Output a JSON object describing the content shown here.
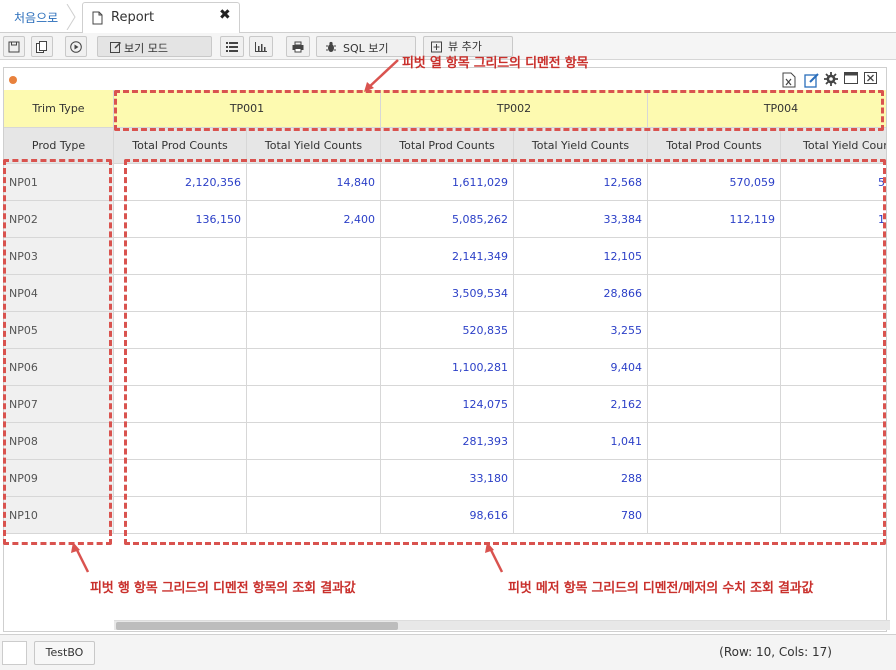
{
  "tabbar": {
    "home_label": "처음으로",
    "tab_label": "Report",
    "close_label": "✖"
  },
  "toolbar": {
    "view_mode_label": "보기 모드",
    "sql_view_label": "SQL 보기",
    "add_view_label": "뷰 추가"
  },
  "grid": {
    "col_dim_header": "Trim Type",
    "row_dim_header": "Prod Type",
    "col_groups": [
      "TP001",
      "TP002",
      "TP004"
    ],
    "measures": [
      "Total Prod Counts",
      "Total Yield Counts",
      "Total Prod Counts",
      "Total Yield Counts",
      "Total Prod Counts",
      "Total Yield Count"
    ],
    "rows": [
      {
        "label": "NP01",
        "values": [
          "2,120,356",
          "14,840",
          "1,611,029",
          "12,568",
          "570,059",
          "5"
        ]
      },
      {
        "label": "NP02",
        "values": [
          "136,150",
          "2,400",
          "5,085,262",
          "33,384",
          "112,119",
          "1"
        ]
      },
      {
        "label": "NP03",
        "values": [
          "",
          "",
          "2,141,349",
          "12,105",
          "",
          ""
        ]
      },
      {
        "label": "NP04",
        "values": [
          "",
          "",
          "3,509,534",
          "28,866",
          "",
          ""
        ]
      },
      {
        "label": "NP05",
        "values": [
          "",
          "",
          "520,835",
          "3,255",
          "",
          ""
        ]
      },
      {
        "label": "NP06",
        "values": [
          "",
          "",
          "1,100,281",
          "9,404",
          "",
          ""
        ]
      },
      {
        "label": "NP07",
        "values": [
          "",
          "",
          "124,075",
          "2,162",
          "",
          ""
        ]
      },
      {
        "label": "NP08",
        "values": [
          "",
          "",
          "281,393",
          "1,041",
          "",
          ""
        ]
      },
      {
        "label": "NP09",
        "values": [
          "",
          "",
          "33,180",
          "288",
          "",
          ""
        ]
      },
      {
        "label": "NP10",
        "values": [
          "",
          "",
          "98,616",
          "780",
          "",
          ""
        ]
      }
    ]
  },
  "annotations": {
    "col_dim": "피벗 열 항목 그리드의 디멘전 항목",
    "row_dim": "피벗 행 항목 그리드의 디멘전 항목의 조회 결과값",
    "measure": "피벗 메저 항목 그리드의 디멘전/메저의 수치 조회 결과값"
  },
  "statusbar": {
    "button_label": "TestBO",
    "info": "(Row: 10, Cols: 17)"
  },
  "colors": {
    "annotation": "#d9534f",
    "header_yellow": "#fdfab0",
    "value_blue": "#2b3fc7",
    "dot_orange": "#e8813d"
  }
}
